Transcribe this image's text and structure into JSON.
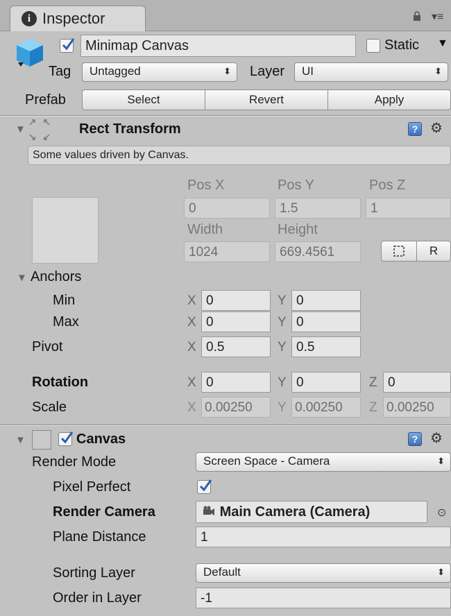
{
  "tab": {
    "title": "Inspector"
  },
  "header": {
    "object_name": "Minimap Canvas",
    "static_label": "Static",
    "tag_label": "Tag",
    "tag_value": "Untagged",
    "layer_label": "Layer",
    "layer_value": "UI",
    "prefab_label": "Prefab",
    "prefab_buttons": [
      "Select",
      "Revert",
      "Apply"
    ]
  },
  "rect_transform": {
    "title": "Rect Transform",
    "notice": "Some values driven by Canvas.",
    "pos_x_label": "Pos X",
    "pos_y_label": "Pos Y",
    "pos_z_label": "Pos Z",
    "pos_x": "0",
    "pos_y": "1.5",
    "pos_z": "1",
    "width_label": "Width",
    "height_label": "Height",
    "width": "1024",
    "height": "669.4561",
    "raw_button": "R",
    "anchors_label": "Anchors",
    "min_label": "Min",
    "max_label": "Max",
    "min_x": "0",
    "min_y": "0",
    "max_x": "0",
    "max_y": "0",
    "pivot_label": "Pivot",
    "pivot_x": "0.5",
    "pivot_y": "0.5",
    "rotation_label": "Rotation",
    "rot_x": "0",
    "rot_y": "0",
    "rot_z": "0",
    "scale_label": "Scale",
    "scale_x": "0.00250",
    "scale_y": "0.00250",
    "scale_z": "0.00250",
    "axis_x": "X",
    "axis_y": "Y",
    "axis_z": "Z"
  },
  "canvas": {
    "title": "Canvas",
    "render_mode_label": "Render Mode",
    "render_mode": "Screen Space - Camera",
    "pixel_perfect_label": "Pixel Perfect",
    "render_camera_label": "Render Camera",
    "render_camera": "Main Camera (Camera)",
    "plane_distance_label": "Plane Distance",
    "plane_distance": "1",
    "sorting_layer_label": "Sorting Layer",
    "sorting_layer": "Default",
    "order_label": "Order in Layer",
    "order": "-1"
  },
  "icons": [
    "info-icon",
    "lock-icon",
    "tab-menu-icon",
    "cube-icon",
    "rect-transform-icon",
    "help-icon",
    "gear-icon",
    "blueprint-icon",
    "camera-icon",
    "object-picker-icon"
  ],
  "colors": {
    "panel_bg": "#c2c2c2",
    "field_bg": "#e6e6e6",
    "check_blue": "#2b5fb0"
  }
}
